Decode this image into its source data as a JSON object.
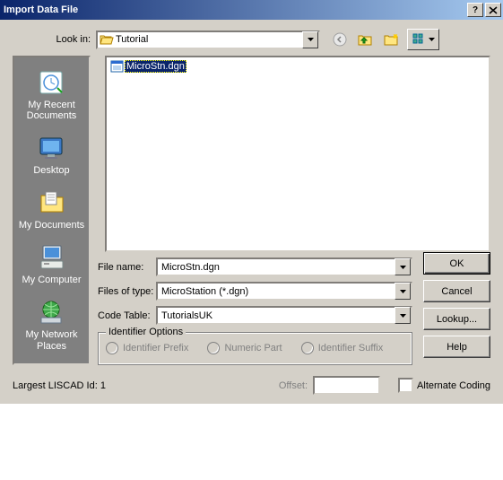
{
  "title": "Import Data File",
  "lookin_label": "Look in:",
  "lookin_value": "Tutorial",
  "file_selected": "MicroStn.dgn",
  "places": [
    {
      "label": "My Recent Documents"
    },
    {
      "label": "Desktop"
    },
    {
      "label": "My Documents"
    },
    {
      "label": "My Computer"
    },
    {
      "label": "My Network Places"
    }
  ],
  "filename_label": "File name:",
  "filename_value": "MicroStn.dgn",
  "filetype_label": "Files of type:",
  "filetype_value": "MicroStation (*.dgn)",
  "codetable_label": "Code Table:",
  "codetable_value": "TutorialsUK",
  "identifier_group": "Identifier Options",
  "id_prefix": "Identifier Prefix",
  "id_numeric": "Numeric Part",
  "id_suffix": "Identifier Suffix",
  "btn_ok": "OK",
  "btn_cancel": "Cancel",
  "btn_lookup": "Lookup...",
  "btn_help": "Help",
  "status_id": "Largest LISCAD Id: 1",
  "offset_label": "Offset:",
  "altcoding_label": "Alternate Coding"
}
